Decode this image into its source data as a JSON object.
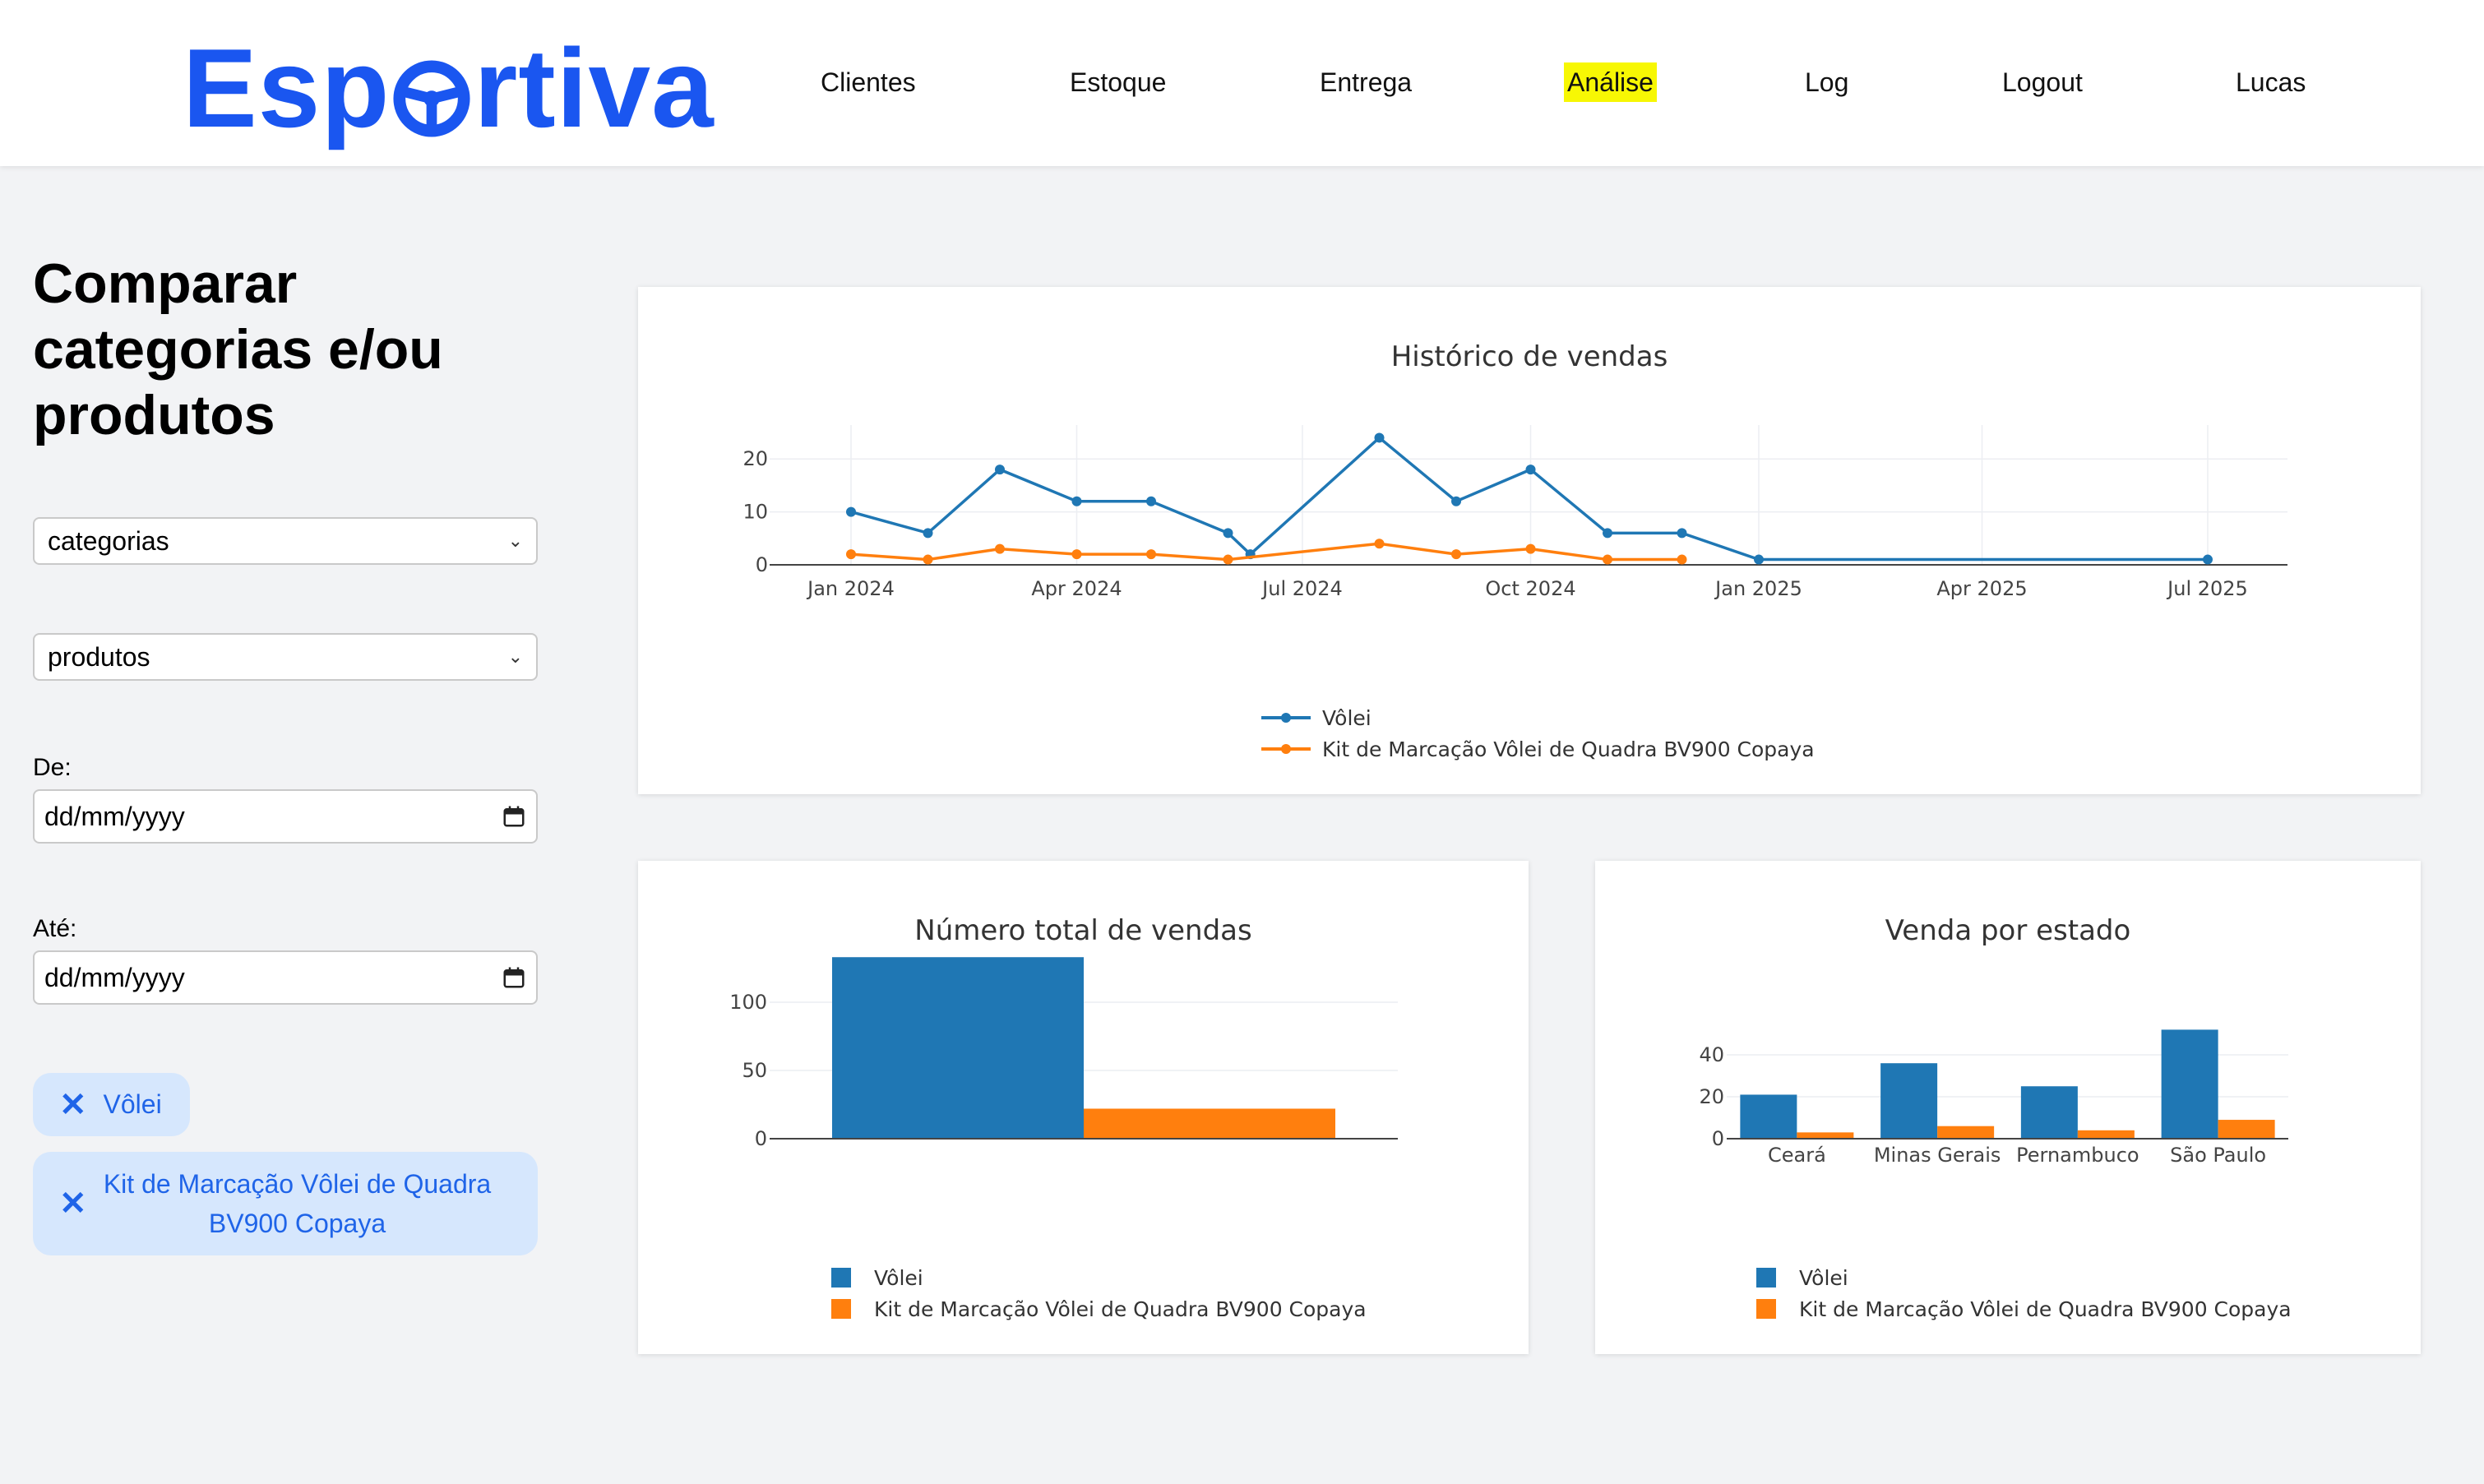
{
  "brand": {
    "logo_text_left": "Esp",
    "logo_text_right": "rtiva",
    "color": "#1a56f0"
  },
  "nav": [
    {
      "label": "Clientes"
    },
    {
      "label": "Estoque"
    },
    {
      "label": "Entrega"
    },
    {
      "label": "Análise",
      "active": true
    },
    {
      "label": "Log"
    },
    {
      "label": "Logout"
    },
    {
      "label": "Lucas"
    }
  ],
  "sidebar": {
    "title": "Comparar categorias e/ou produtos",
    "category_select": "categorias",
    "product_select": "produtos",
    "from_label": "De:",
    "from_value": "dd/mm/yyyy",
    "to_label": "Até:",
    "to_value": "dd/mm/yyyy",
    "chips": [
      {
        "label": "Vôlei"
      },
      {
        "label": "Kit de Marcação Vôlei de Quadra BV900 Copaya"
      }
    ],
    "chip_color": "#d6e7fd"
  },
  "colors": {
    "series1": "#1f77b4",
    "series2": "#ff7f0e",
    "highlight": "#f7f704"
  },
  "chart_data": [
    {
      "type": "line",
      "title": "Histórico de vendas",
      "x_ticks": [
        "Jan 2024",
        "Apr 2024",
        "Jul 2024",
        "Oct 2024",
        "Jan 2025",
        "Apr 2025",
        "Jul 2025"
      ],
      "x_tick_dates": [
        "2024-01-01",
        "2024-04-01",
        "2024-07-01",
        "2024-10-01",
        "2025-01-01",
        "2025-04-01",
        "2025-07-01"
      ],
      "y_ticks": [
        0,
        10,
        20
      ],
      "ylim": [
        0,
        25
      ],
      "series": [
        {
          "name": "Vôlei",
          "x": [
            "2024-01-01",
            "2024-02-01",
            "2024-03-01",
            "2024-04-01",
            "2024-05-01",
            "2024-06-01",
            "2024-06-10",
            "2024-08-01",
            "2024-09-01",
            "2024-10-01",
            "2024-11-01",
            "2024-12-01",
            "2025-01-01",
            "2025-07-01"
          ],
          "y": [
            10,
            6,
            18,
            12,
            12,
            6,
            2,
            24,
            12,
            18,
            6,
            6,
            1,
            1
          ]
        },
        {
          "name": "Kit de Marcação Vôlei de Quadra BV900 Copaya",
          "x": [
            "2024-01-01",
            "2024-02-01",
            "2024-03-01",
            "2024-04-01",
            "2024-05-01",
            "2024-06-01",
            "2024-08-01",
            "2024-09-01",
            "2024-10-01",
            "2024-11-01",
            "2024-12-01"
          ],
          "y": [
            2,
            1,
            3,
            2,
            2,
            1,
            4,
            2,
            3,
            1,
            1
          ]
        }
      ],
      "legend": "bottom-center"
    },
    {
      "type": "bar",
      "title": "Número total de vendas",
      "y_ticks": [
        0,
        50,
        100
      ],
      "ylim": [
        0,
        140
      ],
      "series": [
        {
          "name": "Vôlei",
          "values": [
            133
          ]
        },
        {
          "name": "Kit de Marcação Vôlei de Quadra BV900 Copaya",
          "values": [
            22
          ]
        }
      ],
      "legend": "bottom-center"
    },
    {
      "type": "bar",
      "title": "Venda por estado",
      "categories": [
        "Ceará",
        "Minas Gerais",
        "Pernambuco",
        "São Paulo"
      ],
      "y_ticks": [
        0,
        20,
        40
      ],
      "ylim": [
        0,
        55
      ],
      "series": [
        {
          "name": "Vôlei",
          "values": [
            21,
            36,
            25,
            52
          ]
        },
        {
          "name": "Kit de Marcação Vôlei de Quadra BV900 Copaya",
          "values": [
            3,
            6,
            4,
            9
          ]
        }
      ],
      "legend": "bottom-center"
    }
  ]
}
